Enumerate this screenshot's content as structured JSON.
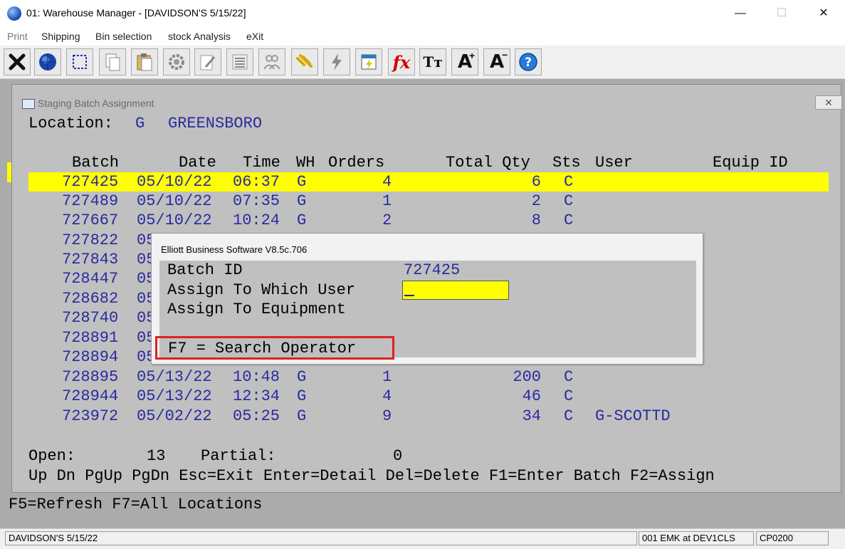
{
  "window": {
    "title": "01: Warehouse Manager - [DAVIDSON'S 5/15/22]",
    "minimize": "—",
    "maximize": "☐",
    "close": "✕"
  },
  "menu": [
    {
      "label": "Print",
      "enabled": false
    },
    {
      "label": "Shipping",
      "enabled": true
    },
    {
      "label": "Bin selection",
      "enabled": true
    },
    {
      "label": "stock Analysis",
      "enabled": true
    },
    {
      "label": "eXit",
      "enabled": true
    }
  ],
  "toolbar": [
    "close-x-icon",
    "globe-icon",
    "select-rect-icon",
    "copy-icon",
    "paste-icon",
    "gear-icon",
    "edit-icon",
    "list-icon",
    "users-icon",
    "link-icon",
    "lightning-icon",
    "calculator-icon",
    "fx-icon",
    "text-size-icon",
    "font-bigger-icon",
    "font-smaller-icon",
    "help-icon"
  ],
  "toolbar_glyphs": {
    "fx": "fx",
    "text_size": "Tт",
    "font_bigger": "A",
    "font_smaller": "A",
    "help": "?"
  },
  "child": {
    "title": "Staging Batch Assignment",
    "close": "✕"
  },
  "location": {
    "label": "Location:",
    "code": "G",
    "name": "GREENSBORO"
  },
  "columns": {
    "batch": "Batch",
    "date": "Date",
    "time": "Time",
    "wh": "WH",
    "orders": "Orders",
    "total_qty": "Total Qty",
    "sts": "Sts",
    "user": "User",
    "equip": "Equip ID"
  },
  "rows": [
    {
      "batch": "727425",
      "date": "05/10/22",
      "time": "06:37",
      "wh": "G",
      "orders": "4",
      "qty": "6",
      "sts": "C",
      "user": "",
      "selected": true
    },
    {
      "batch": "727489",
      "date": "05/10/22",
      "time": "07:35",
      "wh": "G",
      "orders": "1",
      "qty": "2",
      "sts": "C",
      "user": ""
    },
    {
      "batch": "727667",
      "date": "05/10/22",
      "time": "10:24",
      "wh": "G",
      "orders": "2",
      "qty": "8",
      "sts": "C",
      "user": ""
    },
    {
      "batch": "727822",
      "partial": "05"
    },
    {
      "batch": "727843",
      "partial": "05"
    },
    {
      "batch": "728447",
      "partial": "05"
    },
    {
      "batch": "728682",
      "partial": "05"
    },
    {
      "batch": "728740",
      "partial": "05"
    },
    {
      "batch": "728891",
      "partial": "05"
    },
    {
      "batch": "728894",
      "partial": "05"
    },
    {
      "batch": "728895",
      "date": "05/13/22",
      "time": "10:48",
      "wh": "G",
      "orders": "1",
      "qty": "200",
      "sts": "C",
      "user": ""
    },
    {
      "batch": "728944",
      "date": "05/13/22",
      "time": "12:34",
      "wh": "G",
      "orders": "4",
      "qty": "46",
      "sts": "C",
      "user": ""
    },
    {
      "batch": "723972",
      "date": "05/02/22",
      "time": "05:25",
      "wh": "G",
      "orders": "9",
      "qty": "34",
      "sts": "C",
      "user": "G-SCOTTD"
    }
  ],
  "summary": {
    "open_label": "Open:",
    "open_value": "13",
    "partial_label": "Partial:",
    "partial_value": "0"
  },
  "keys_line": "Up Dn PgUp PgDn Esc=Exit Enter=Detail Del=Delete F1=Enter Batch F2=Assign",
  "background_line": "F5=Refresh F7=All Locations",
  "dialog": {
    "title": "Elliott Business Software V8.5c.706",
    "batch_label": "Batch ID",
    "batch_value": "727425",
    "user_label": "Assign To Which User",
    "user_value": "",
    "equip_label": "Assign To Equipment",
    "hint": "F7 = Search Operator"
  },
  "statusbar": {
    "left": "DAVIDSON'S 5/15/22",
    "middle": "001 EMK at DEV1CLS",
    "right": "CP0200"
  },
  "colors": {
    "selection": "#ffff00",
    "data_text": "#2a2aa0",
    "highlight_box": "#e02020"
  }
}
